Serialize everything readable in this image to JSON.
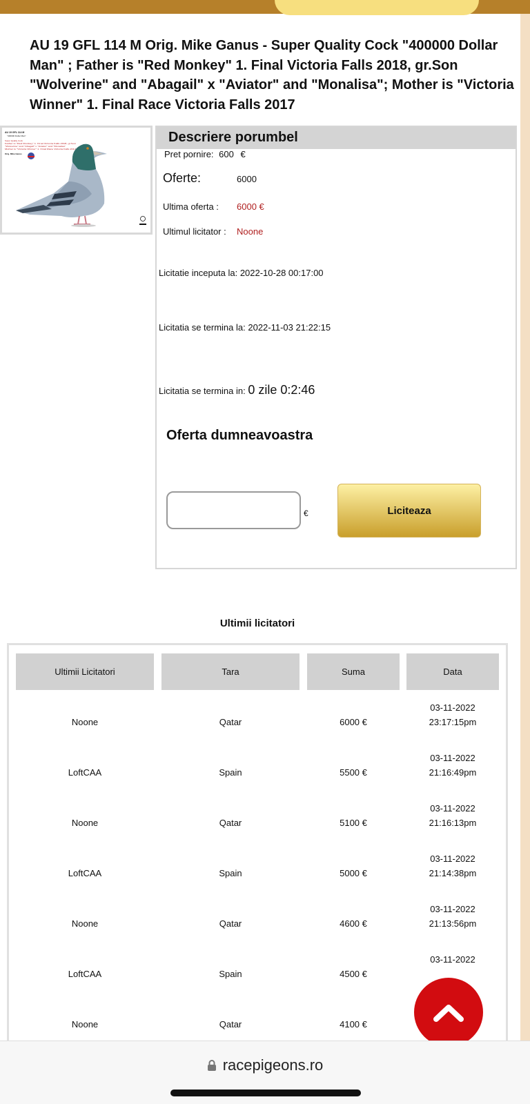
{
  "listing": {
    "title": "AU 19 GFL 114 M Orig. Mike Ganus - Super Quality Cock \"400000 Dollar Man\" ; Father is \"Red Monkey\" 1. Final Victoria Falls 2018, gr.Son \"Wolverine\" and \"Abagail\" x \"Aviator\" and \"Monalisa\"; Mother is \"Victoria Winner\" 1. Final Race Victoria Falls 2017"
  },
  "thumbnail": {
    "lines": [
      "AU 19 GFL 114 M",
      "\"400000 Dollar Man\"",
      "Super Quality Cock",
      "Father is \"Red Monkey\" 1. Final Victoria Falls 2018, gr.Son",
      "\"Wolverine\" and \"Abagail\" x \"Aviator\" and \"Monalisa\"",
      "Mother is \"Victoria Winner\" 1. Final Race Victoria Falls 2017",
      "Orig. Mike Ganus"
    ]
  },
  "description": {
    "header": "Descriere porumbel",
    "start_price_label": "Pret pornire:",
    "start_price_value": "600",
    "start_price_currency": "€",
    "offers_label": "Oferte:",
    "offers_value": "6000",
    "last_offer_label": "Ultima oferta :",
    "last_offer_value": "6000 €",
    "last_bidder_label": "Ultimul licitator :",
    "last_bidder_value": "Noone",
    "started_label": "Licitatie inceputa la:",
    "started_value": "2022-10-28 00:17:00",
    "ends_at_label": "Licitatia se termina la:",
    "ends_at_value": "2022-11-03 21:22:15",
    "ends_in_label": "Licitatia se termina in:",
    "ends_in_value": "0 zile 0:2:46"
  },
  "bid": {
    "title": "Oferta dumneavoastra",
    "input_value": "",
    "currency": "€",
    "button_label": "Liciteaza"
  },
  "bidders": {
    "caption": "Ultimii licitatori",
    "headers": [
      "Ultimii Licitatori",
      "Tara",
      "Suma",
      "Data"
    ],
    "rows": [
      {
        "name": "Noone",
        "country": "Qatar",
        "amount": "6000 €",
        "date": "03-11-2022",
        "time": "23:17:15pm"
      },
      {
        "name": "LoftCAA",
        "country": "Spain",
        "amount": "5500 €",
        "date": "03-11-2022",
        "time": "21:16:49pm"
      },
      {
        "name": "Noone",
        "country": "Qatar",
        "amount": "5100 €",
        "date": "03-11-2022",
        "time": "21:16:13pm"
      },
      {
        "name": "LoftCAA",
        "country": "Spain",
        "amount": "5000 €",
        "date": "03-11-2022",
        "time": "21:14:38pm"
      },
      {
        "name": "Noone",
        "country": "Qatar",
        "amount": "4600 €",
        "date": "03-11-2022",
        "time": "21:13:56pm"
      },
      {
        "name": "LoftCAA",
        "country": "Spain",
        "amount": "4500 €",
        "date": "03-11-2022",
        "time": ""
      },
      {
        "name": "Noone",
        "country": "Qatar",
        "amount": "4100 €",
        "date": "",
        "time": ""
      }
    ]
  },
  "browser": {
    "url": "racepigeons.ro",
    "lock_icon": "lock-icon"
  },
  "scroll_top": {
    "icon": "chevron-up-icon"
  },
  "colors": {
    "top_bar": "#b6802a",
    "price_red": "#b02020",
    "fab_red": "#d20c10",
    "button_gold": "#c99f2c"
  }
}
